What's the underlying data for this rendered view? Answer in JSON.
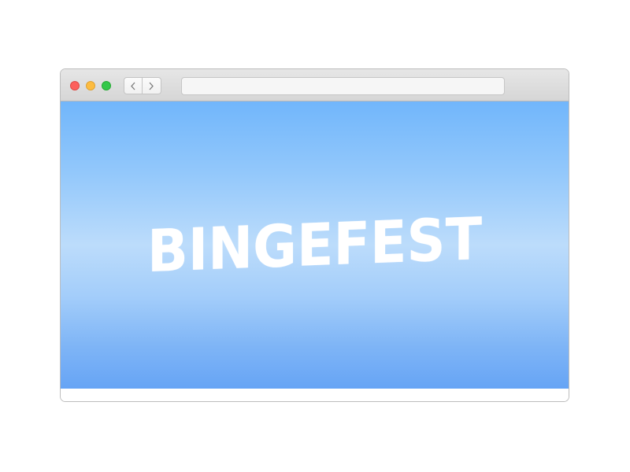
{
  "window": {
    "traffic_lights": {
      "close": "red-close-icon",
      "minimize": "yellow-minimize-icon",
      "maximize": "green-maximize-icon"
    },
    "nav": {
      "back_icon": "chevron-left-icon",
      "forward_icon": "chevron-right-icon"
    },
    "address_bar": {
      "value": ""
    }
  },
  "page": {
    "title": "BINGEFEST",
    "background_colors": [
      "#71b6fb",
      "#bcdcfb",
      "#66a4f5"
    ],
    "title_color": "#ffffff"
  }
}
